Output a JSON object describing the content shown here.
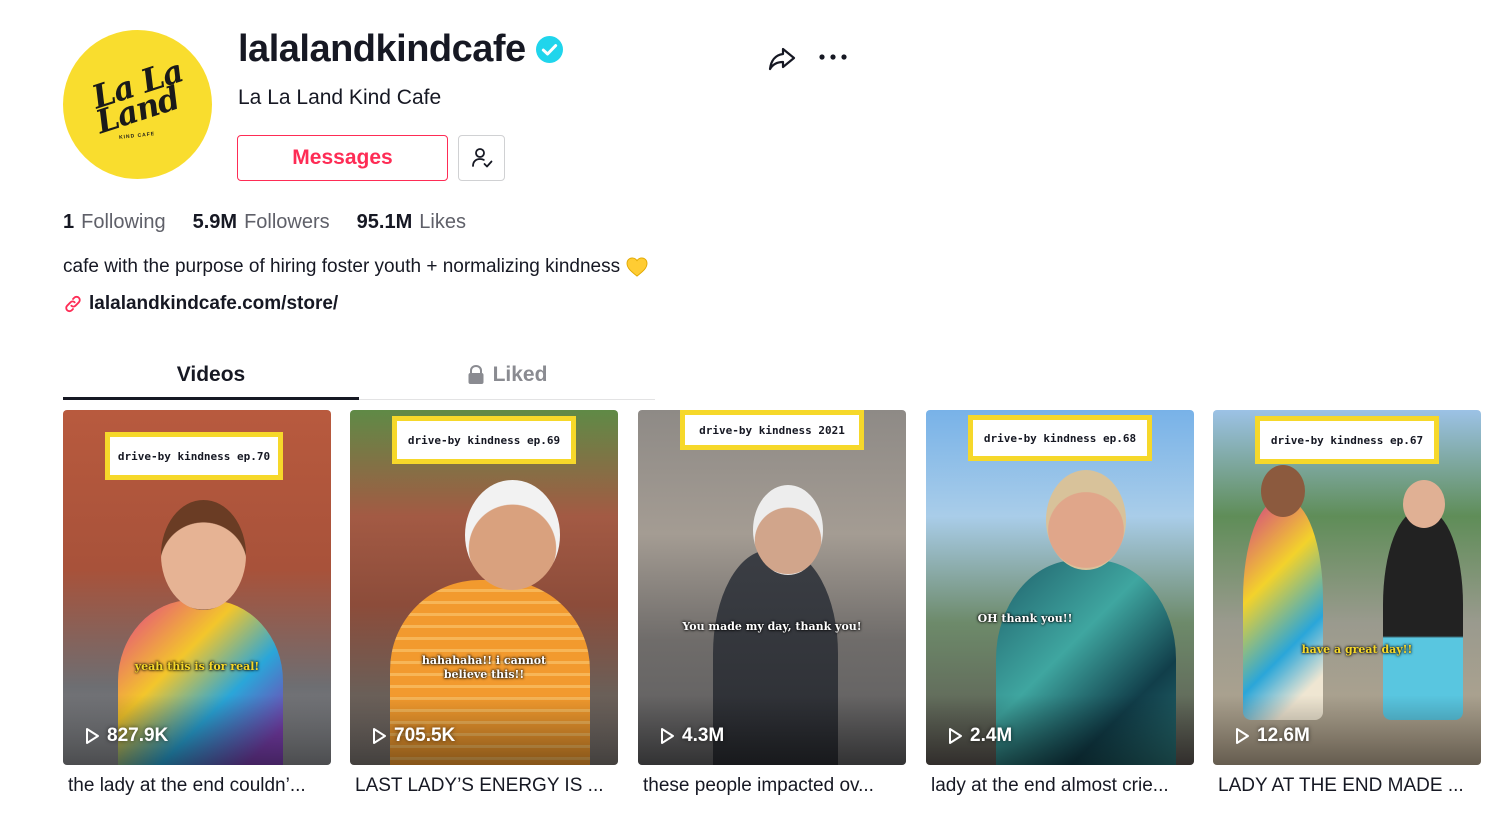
{
  "profile": {
    "avatar_logo": [
      "La La",
      "Land"
    ],
    "avatar_logo_small": "KIND CAFE",
    "username": "lalalandkindcafe",
    "nickname": "La La Land Kind Cafe",
    "verified": true,
    "messages_label": "Messages"
  },
  "stats": {
    "following_count": "1",
    "following_label": "Following",
    "followers_count": "5.9M",
    "followers_label": "Followers",
    "likes_count": "95.1M",
    "likes_label": "Likes"
  },
  "bio": "cafe with the purpose of hiring foster youth + normalizing kindness",
  "link": "lalalandkindcafe.com/store/",
  "tabs": [
    {
      "label": "Videos",
      "active": true
    },
    {
      "label": "Liked",
      "active": false,
      "locked": true
    }
  ],
  "videos": [
    {
      "banner": "drive-by kindness ep.70",
      "caption": "yeah this is for real!",
      "caption_style": "yellow",
      "views": "827.9K",
      "description": "the lady at the end couldn’..."
    },
    {
      "banner": "drive-by kindness ep.69",
      "caption": "hahahaha!! i cannot believe this!!",
      "caption_style": "white",
      "views": "705.5K",
      "description": "LAST LADY’S ENERGY IS ..."
    },
    {
      "banner": "drive-by kindness 2021",
      "caption": "You made my day, thank you!",
      "caption_style": "white",
      "views": "4.3M",
      "description": "these people impacted ov..."
    },
    {
      "banner": "drive-by kindness ep.68",
      "caption": "OH thank you!!",
      "caption_style": "white",
      "views": "2.4M",
      "description": "lady at the end almost crie..."
    },
    {
      "banner": "drive-by kindness ep.67",
      "caption": "have a great day!!",
      "caption_style": "yellow",
      "views": "12.6M",
      "description": "LADY AT THE END MADE ..."
    }
  ],
  "colors": {
    "accent": "#fe2c55",
    "verified": "#20d5ec",
    "avatar_bg": "#f9dd2e",
    "banner_border": "#f6d82a"
  },
  "icons": {
    "share": "share-arrow-icon",
    "more": "ellipsis-icon",
    "follow": "person-check-icon",
    "link": "link-chain-icon",
    "lock": "lock-icon",
    "play": "play-icon",
    "heart": "yellow-heart-emoji"
  }
}
